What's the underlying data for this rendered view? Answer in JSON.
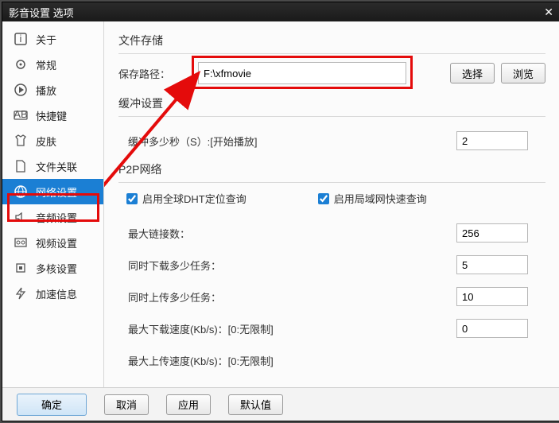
{
  "window": {
    "title": "影音设置 选项"
  },
  "sidebar": [
    {
      "label": "关于"
    },
    {
      "label": "常规"
    },
    {
      "label": "播放"
    },
    {
      "label": "快捷键"
    },
    {
      "label": "皮肤"
    },
    {
      "label": "文件关联"
    },
    {
      "label": "网络设置"
    },
    {
      "label": "音频设置"
    },
    {
      "label": "视频设置"
    },
    {
      "label": "多核设置"
    },
    {
      "label": "加速信息"
    }
  ],
  "main": {
    "file_storage": {
      "title": "文件存储",
      "path_label": "保存路径：",
      "path_value": "F:\\xfmovie",
      "select_btn": "选择",
      "browse_btn": "浏览"
    },
    "buffer": {
      "title": "缓冲设置",
      "label": "缓冲多少秒（S）:[开始播放]",
      "value": "2"
    },
    "p2p": {
      "title": "P2P网络",
      "dht_label": "启用全球DHT定位查询",
      "lan_label": "启用局域网快速查询",
      "max_conn_label": "最大链接数：",
      "max_conn_value": "256",
      "down_tasks_label": "同时下载多少任务：",
      "down_tasks_value": "5",
      "up_tasks_label": "同时上传多少任务：",
      "up_tasks_value": "10",
      "max_down_label": "最大下载速度(Kb/s)：[0:无限制]",
      "max_down_value": "0",
      "max_up_label": "最大上传速度(Kb/s)：[0:无限制]"
    }
  },
  "footer": {
    "ok": "确定",
    "cancel": "取消",
    "apply": "应用",
    "defaults": "默认值"
  }
}
